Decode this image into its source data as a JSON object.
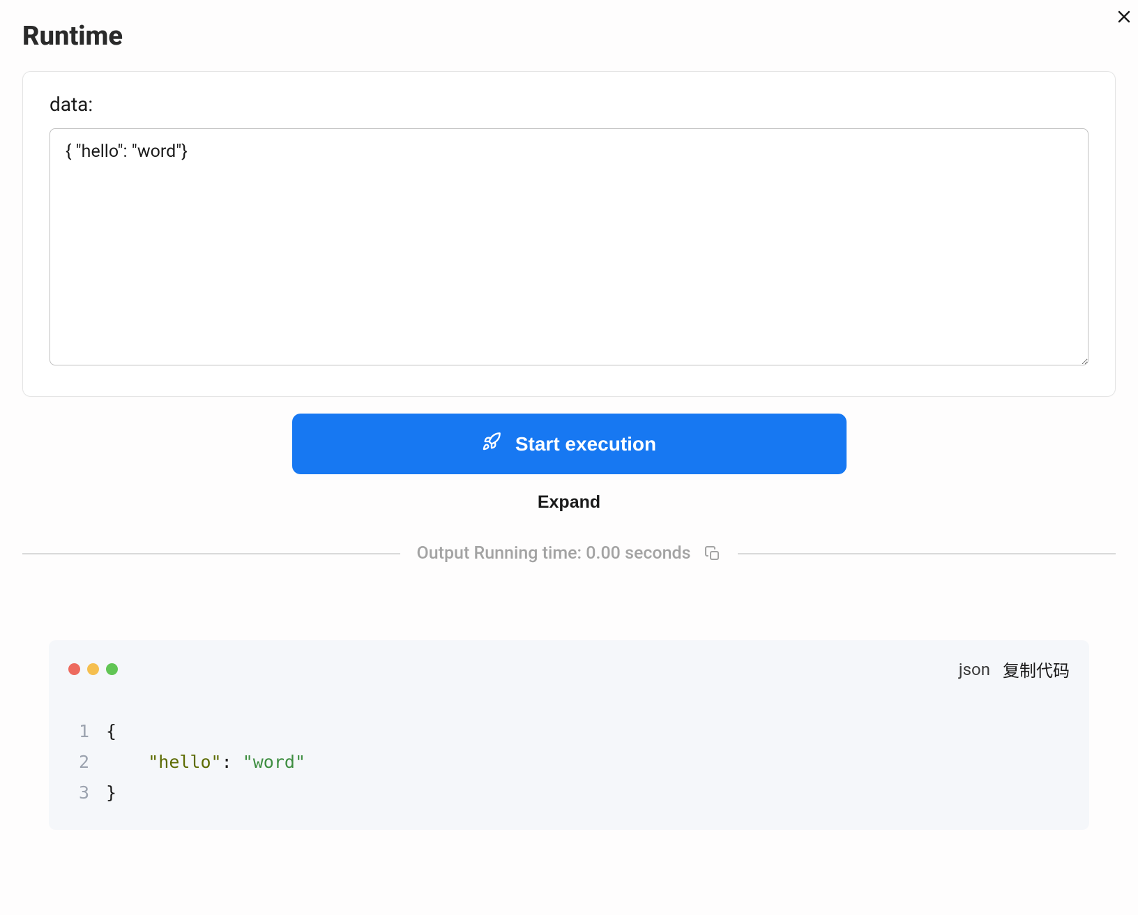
{
  "header": {
    "title": "Runtime"
  },
  "input": {
    "label": "data:",
    "value": "{ \"hello\": \"word\"}"
  },
  "actions": {
    "start_label": "Start execution",
    "expand_label": "Expand"
  },
  "output": {
    "label": "Output Running time: 0.00 seconds"
  },
  "code": {
    "language": "json",
    "copy_label": "复制代码",
    "lines": [
      {
        "num": "1",
        "indent": "",
        "open": "{",
        "key": "",
        "colon": "",
        "val": "",
        "close": ""
      },
      {
        "num": "2",
        "indent": "    ",
        "open": "",
        "key": "\"hello\"",
        "colon": ": ",
        "val": "\"word\"",
        "close": ""
      },
      {
        "num": "3",
        "indent": "",
        "open": "",
        "key": "",
        "colon": "",
        "val": "",
        "close": "}"
      }
    ]
  }
}
